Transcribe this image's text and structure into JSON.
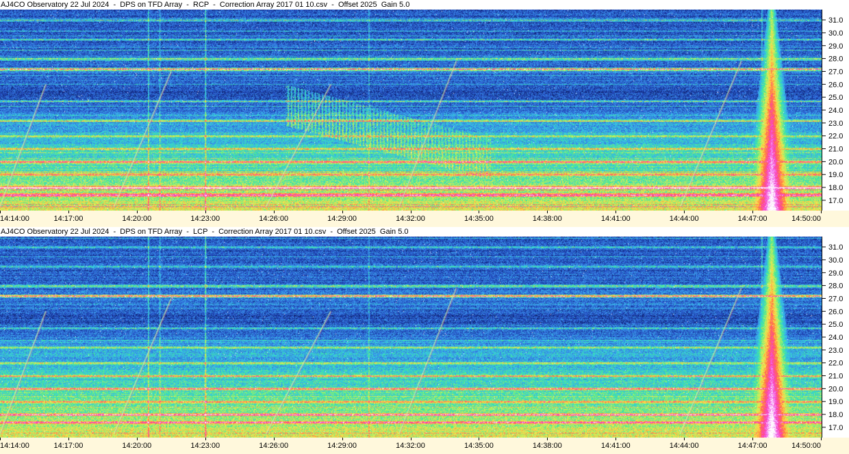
{
  "panels": [
    {
      "title": "AJ4CO Observatory 22 Jul 2024  -  DPS on TFD Array  -  RCP  -  Correction Array 2017 01 10.csv  -  Offset 2025  Gain 5.0",
      "polarization": "RCP"
    },
    {
      "title": "AJ4CO Observatory 22 Jul 2024  -  DPS on TFD Array  -  LCP  -  Correction Array 2017 01 10.csv  -  Offset 2025  Gain 5.0",
      "polarization": "LCP"
    }
  ],
  "chart_data": {
    "type": "heatmap",
    "x_ticks": [
      "14:14:00",
      "14:17:00",
      "14:20:00",
      "14:23:00",
      "14:26:00",
      "14:29:00",
      "14:32:00",
      "14:35:00",
      "14:38:00",
      "14:41:00",
      "14:44:00",
      "14:47:00",
      "14:50:00"
    ],
    "y_ticks": [
      "31.0",
      "30.0",
      "29.0",
      "28.0",
      "27.0",
      "26.0",
      "25.0",
      "24.0",
      "23.0",
      "22.0",
      "21.0",
      "20.0",
      "19.0",
      "18.0",
      "17.0"
    ],
    "x_range": [
      "14:14:00",
      "14:50:00"
    ],
    "y_range": [
      16.2,
      31.8
    ],
    "colormap": [
      "#0a1240",
      "#14308f",
      "#2a5ad0",
      "#3a8ee8",
      "#35c8e6",
      "#3ee89a",
      "#b8f060",
      "#ffe14a",
      "#ff7a3a",
      "#ff3fa0",
      "#f060f0",
      "#ffffff"
    ],
    "features": [
      {
        "kind": "interference_band",
        "freq": 27.2,
        "strength": 1.0
      },
      {
        "kind": "interference_band",
        "freq": 28.0,
        "strength": 0.5
      },
      {
        "kind": "interference_band",
        "freq": 18.0,
        "strength": 0.7
      },
      {
        "kind": "interference_band",
        "freq": 17.4,
        "strength": 0.6
      },
      {
        "kind": "interference_band",
        "freq": 20.0,
        "strength": 0.6
      },
      {
        "kind": "interference_band",
        "freq": 21.0,
        "strength": 0.5
      },
      {
        "kind": "interference_band",
        "freq": 19.0,
        "strength": 0.45
      },
      {
        "kind": "interference_band",
        "freq": 22.0,
        "strength": 0.4
      },
      {
        "kind": "interference_band",
        "freq": 23.2,
        "strength": 0.4
      },
      {
        "kind": "interference_band",
        "freq": 24.7,
        "strength": 0.45
      },
      {
        "kind": "interference_band",
        "freq": 29.5,
        "strength": 0.35
      },
      {
        "kind": "interference_band",
        "freq": 31.0,
        "strength": 0.3
      },
      {
        "kind": "vertical_line",
        "time": "14:20:30",
        "strength": 0.55
      },
      {
        "kind": "vertical_line",
        "time": "14:21:00",
        "strength": 0.35
      },
      {
        "kind": "vertical_line",
        "time": "14:23:00",
        "strength": 0.6
      },
      {
        "kind": "vertical_line",
        "time": "14:30:10",
        "strength": 0.35
      },
      {
        "kind": "vertical_line",
        "time": "14:47:24",
        "strength": 0.5
      },
      {
        "kind": "drift_line",
        "start_time": "14:14:00",
        "start_freq": 16.5,
        "end_time": "14:16:00",
        "end_freq": 26.0
      },
      {
        "kind": "drift_line",
        "start_time": "14:19:00",
        "start_freq": 16.5,
        "end_time": "14:21:30",
        "end_freq": 27.0
      },
      {
        "kind": "drift_line",
        "start_time": "14:25:40",
        "start_freq": 16.5,
        "end_time": "14:28:30",
        "end_freq": 26.0
      },
      {
        "kind": "drift_line",
        "start_time": "14:31:30",
        "start_freq": 16.5,
        "end_time": "14:34:00",
        "end_freq": 27.8
      },
      {
        "kind": "drift_line",
        "start_time": "14:43:50",
        "start_freq": 16.5,
        "end_time": "14:46:30",
        "end_freq": 27.8
      },
      {
        "kind": "noise_storm",
        "time": "14:47:50",
        "low_freq": 16.5,
        "high_freq": 32.0
      },
      {
        "kind": "s_burst_region",
        "start_time": "14:26:30",
        "end_time": "14:35:30",
        "low_freq": 20.0,
        "high_freq": 26.0,
        "panel": "RCP"
      },
      {
        "kind": "quiet_region",
        "low_freq": 23.5,
        "high_freq": 26.5
      }
    ]
  }
}
